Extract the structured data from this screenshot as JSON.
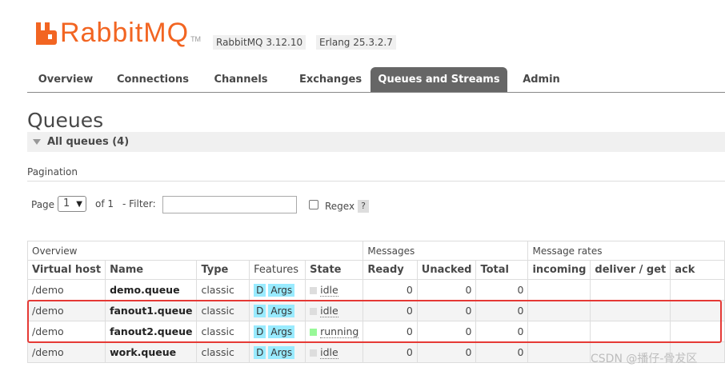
{
  "header": {
    "logo_text": "RabbitMQ",
    "logo_tm": "TM",
    "brand_color": "#f26522",
    "version": "RabbitMQ 3.12.10",
    "erlang": "Erlang 25.3.2.7"
  },
  "nav": {
    "tabs": [
      "Overview",
      "Connections",
      "Channels",
      "Exchanges",
      "Queues and Streams",
      "Admin"
    ],
    "active": "Queues and Streams"
  },
  "page": {
    "title": "Queues",
    "section": "All queues (4)"
  },
  "pagination": {
    "label": "Pagination",
    "page_label": "Page",
    "page_value": "1",
    "of_label": "of 1",
    "filter_label": "- Filter:",
    "filter_value": "",
    "regex_label": "Regex",
    "help": "?"
  },
  "table": {
    "groups": [
      "Overview",
      "Messages",
      "Message rates"
    ],
    "columns": [
      "Virtual host",
      "Name",
      "Type",
      "Features",
      "State",
      "Ready",
      "Unacked",
      "Total",
      "incoming",
      "deliver / get",
      "ack"
    ],
    "rows": [
      {
        "vhost": "/demo",
        "name": "demo.queue",
        "type": "classic",
        "f1": "D",
        "f2": "Args",
        "state": "idle",
        "ready": "0",
        "unacked": "0",
        "total": "0"
      },
      {
        "vhost": "/demo",
        "name": "fanout1.queue",
        "type": "classic",
        "f1": "D",
        "f2": "Args",
        "state": "idle",
        "ready": "0",
        "unacked": "0",
        "total": "0"
      },
      {
        "vhost": "/demo",
        "name": "fanout2.queue",
        "type": "classic",
        "f1": "D",
        "f2": "Args",
        "state": "running",
        "ready": "0",
        "unacked": "0",
        "total": "0"
      },
      {
        "vhost": "/demo",
        "name": "work.queue",
        "type": "classic",
        "f1": "D",
        "f2": "Args",
        "state": "idle",
        "ready": "0",
        "unacked": "0",
        "total": "0"
      }
    ]
  },
  "colors": {
    "idle": "#dddddd",
    "running": "#98f898",
    "badge": "#99ebff",
    "highlight": "#e53935"
  },
  "watermark": "CSDN @播仔-骨犮区"
}
